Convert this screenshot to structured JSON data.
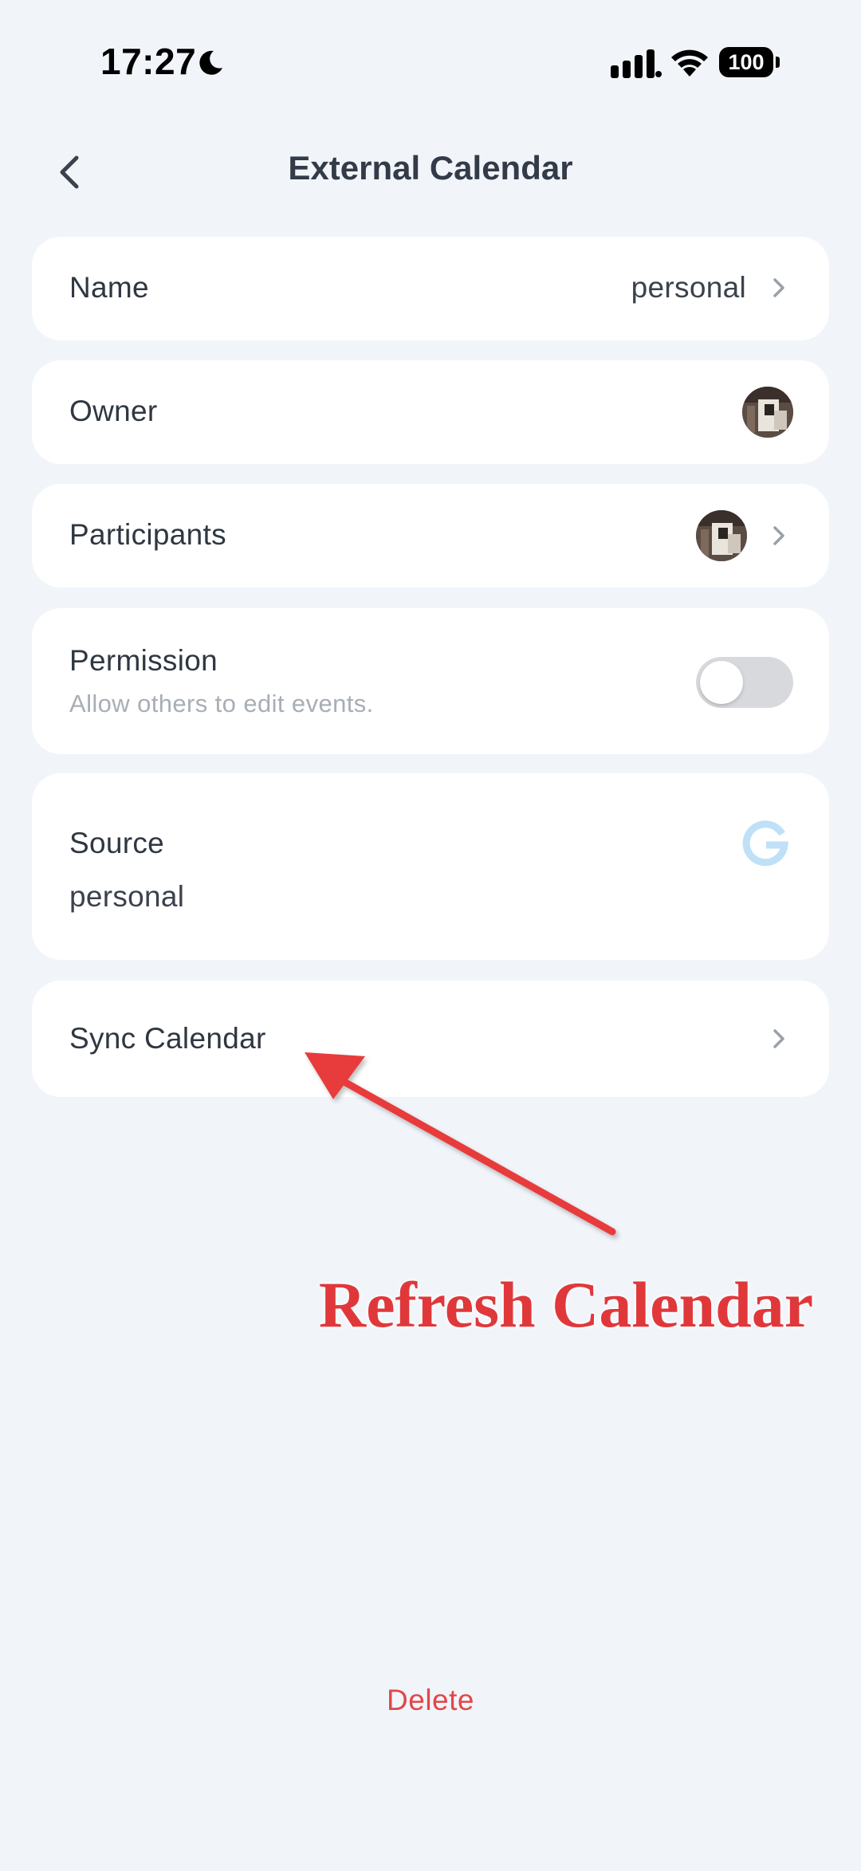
{
  "status_bar": {
    "time": "17:27",
    "battery": "100"
  },
  "header": {
    "title": "External Calendar"
  },
  "rows": {
    "name": {
      "label": "Name",
      "value": "personal"
    },
    "owner": {
      "label": "Owner"
    },
    "participants": {
      "label": "Participants"
    },
    "permission": {
      "label": "Permission",
      "subtitle": "Allow others to edit events.",
      "enabled": false
    },
    "source": {
      "label": "Source",
      "value": "personal"
    },
    "sync": {
      "label": "Sync Calendar"
    }
  },
  "annotation": {
    "text": "Refresh Calendar",
    "color": "#e0383a"
  },
  "footer": {
    "delete_label": "Delete"
  },
  "colors": {
    "background": "#f1f5fa",
    "card": "#ffffff",
    "delete": "#e0484a",
    "google_icon": "#bfe0f7"
  }
}
